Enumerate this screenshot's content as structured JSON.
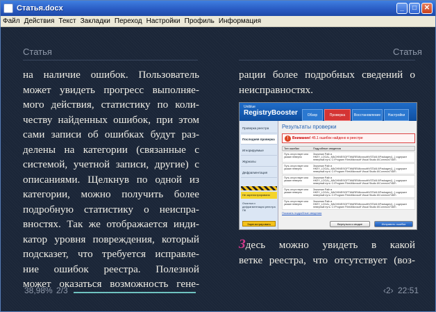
{
  "window": {
    "title": "Статья.docx"
  },
  "menu": [
    "Файл",
    "Действия",
    "Текст",
    "Закладки",
    "Переход",
    "Настройки",
    "Профиль",
    "Информация"
  ],
  "reader": {
    "left_header": "Статья",
    "right_header": "Статья",
    "left_lines": [
      "на наличие ошибок. Пользователь",
      "может увидеть прогресс выполняе-",
      "мого действия, статистику по коли-",
      "честву найденных ошибок, при этом",
      "сами записи об ошибках будут раз-",
      "делены на категории (связанные с",
      "системой, учетной записи, другие) с",
      "описаниями. Щелкнув по одной из",
      "категории, можно получить более",
      "подробную статистику о неиспра-",
      "вностях. Так же отображается инди-",
      "катор уровня повреждения, который",
      "подсказет, что требуется исправле-",
      "ние ошибок реестра. Полезной",
      "может оказаться возможность гене-"
    ],
    "right_top_lines": [
      "рации более подробных сведений о",
      "неисправностях."
    ],
    "right_bottom_first_letter": "З",
    "right_bottom_lines": [
      "десь можно увидеть в какой",
      "ветке реестра, что отсутствует (воз-"
    ],
    "footer": {
      "percent": "38,98%",
      "page": "2/3",
      "nav": "‹2›",
      "time": "22:51",
      "progress": 0.55
    }
  },
  "screenshot": {
    "brand_top": "Uniblue",
    "brand": "RegistryBooster",
    "tabs": [
      "Обзор",
      "Проверка",
      "Восстановление",
      "Настройки"
    ],
    "side_items": [
      "Проверка реестра",
      "Последняя проверка",
      "Игнорируемые",
      "Журналы",
      "Дефрагментация"
    ],
    "side_warn": "Не зарегистрировано",
    "side_extra": "Очистка и дефрагментация реестра ПК",
    "side_button": "Зарегистрировать",
    "results_title": "Результаты проверки",
    "alert_label": "Внимание!",
    "alert_text": "45.1 ошибок найдено в реестре",
    "col1": "Тип ошибки",
    "col2": "Подробные сведения",
    "row_c1": "Путь отсутствует или указан неверно",
    "row_c2": "Значение Path в HKEY_LOCAL_MACHINE\\SOFTWARE\\Microsoft\\VSTA\\8.0\\Packages\\{...} содержит неверный путь: C:\\Program Files\\Microsoft Visual Studio 8\\Common7\\IDE\\",
    "link": "Показать подробные сведения",
    "btn_back": "Вернуться к сводке",
    "btn_fix": "Исправить ошибки"
  }
}
